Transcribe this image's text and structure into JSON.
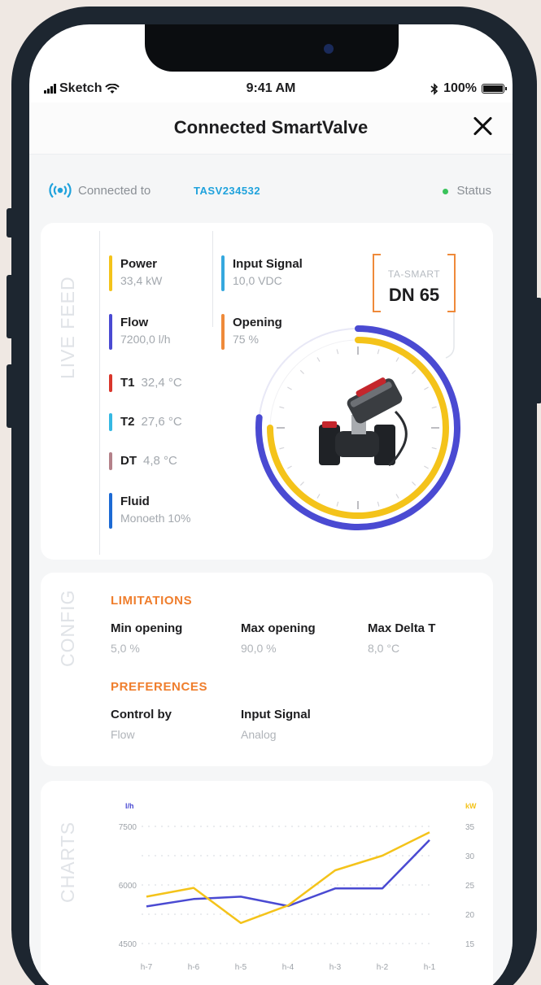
{
  "status_bar": {
    "carrier": "Sketch",
    "time": "9:41 AM",
    "battery": "100%"
  },
  "header": {
    "title": "Connected SmartValve",
    "close_icon": "close-icon"
  },
  "connection": {
    "label": "Connected to",
    "device_id": "TASV234532",
    "status_label": "Status",
    "status_color": "#3ac35b"
  },
  "live_feed": {
    "section_label": "LIVE FEED",
    "metrics": [
      {
        "label": "Power",
        "value": "33,4 kW",
        "color": "#f4c31a"
      },
      {
        "label": "Flow",
        "value": "7200,0 l/h",
        "color": "#4a4ad2"
      },
      {
        "label": "T1",
        "value": "32,4 °C",
        "color": "#d9362b"
      },
      {
        "label": "T2",
        "value": "27,6 °C",
        "color": "#35b8e3"
      },
      {
        "label": "DT",
        "value": "4,8 °C",
        "color": "#b48189"
      },
      {
        "label": "Fluid",
        "value": "Monoeth 10%",
        "color": "#1c6ad4"
      },
      {
        "label": "Input Signal",
        "value": "10,0 VDC",
        "color": "#35a8de"
      },
      {
        "label": "Opening",
        "value": "75 %",
        "color": "#ef8a3a"
      }
    ],
    "valve": {
      "type_label": "TA-SMART",
      "size_label": "DN 65"
    },
    "gauge": {
      "opening_fraction": 0.75,
      "flow_fraction": 0.6
    }
  },
  "config": {
    "section_label": "CONFIG",
    "limitations_title": "LIMITATIONS",
    "limitations": [
      {
        "label": "Min opening",
        "value": "5,0 %"
      },
      {
        "label": "Max opening",
        "value": "90,0 %"
      },
      {
        "label": "Max Delta T",
        "value": "8,0 °C"
      }
    ],
    "preferences_title": "PREFERENCES",
    "preferences": [
      {
        "label": "Control by",
        "value": "Flow"
      },
      {
        "label": "Input Signal",
        "value": "Analog"
      }
    ]
  },
  "charts": {
    "section_label": "CHARTS",
    "chart_data": {
      "type": "line",
      "categories": [
        "h-7",
        "h-6",
        "h-5",
        "h-4",
        "h-3",
        "h-2",
        "h-1"
      ],
      "ylabel_left": "l/h",
      "ylabel_right": "kW",
      "ylim_left": [
        4500,
        7500
      ],
      "ylim_right": [
        15,
        35
      ],
      "yticks_left": [
        "7500",
        "6000",
        "4500"
      ],
      "yticks_right": [
        "35",
        "30",
        "25",
        "20",
        "15"
      ],
      "series": [
        {
          "axis": "left",
          "color": "#4a4ad2",
          "values": [
            5450,
            5640,
            5700,
            5460,
            5910,
            5910,
            7150
          ]
        },
        {
          "axis": "right",
          "color": "#f4c31a",
          "values": [
            23,
            24.5,
            18.5,
            21.5,
            27.5,
            30,
            34
          ]
        }
      ],
      "grid": true
    }
  }
}
